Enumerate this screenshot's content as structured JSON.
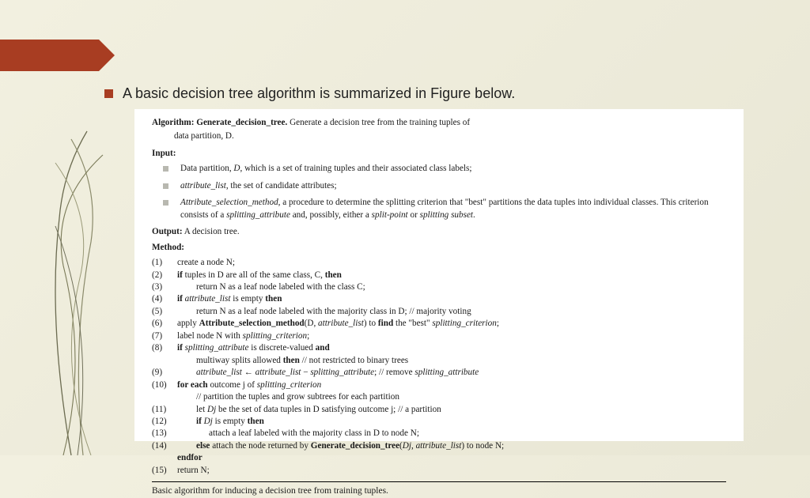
{
  "intro": "A basic decision tree algorithm is summarized in Figure below.",
  "alg": {
    "head_bold": "Algorithm: Generate_decision_tree.",
    "head_rest": " Generate a decision tree from the training tuples of",
    "head_line2": "data partition, D.",
    "input_label": "Input:",
    "inputs": {
      "i1_a": "Data partition, ",
      "i1_b": "D",
      "i1_c": ", which is a set of training tuples and their associated class labels;",
      "i2_a": "attribute_list",
      "i2_b": ", the set of candidate attributes;",
      "i3_a": "Attribute_selection_method",
      "i3_b": ", a procedure to determine the splitting criterion that \"best\" partitions the data tuples into individual classes. This criterion consists of a ",
      "i3_c": "splitting_attribute",
      "i3_d": " and, possibly, either a ",
      "i3_e": "split-point",
      "i3_f": " or ",
      "i3_g": "splitting subset",
      "i3_h": "."
    },
    "output_b": "Output:",
    "output_t": " A decision tree.",
    "method_label": "Method:",
    "s1": "create a node N;",
    "s2_a": "if ",
    "s2_b": "tuples in D are all of the same class, C, ",
    "s2_c": "then",
    "s3": "return N as a leaf node labeled with the class C;",
    "s4_a": "if ",
    "s4_b": "attribute_list",
    "s4_c": " is empty ",
    "s4_d": "then",
    "s5_a": "return N as a leaf node labeled with the majority class in D; ",
    "s5_b": "// majority voting",
    "s6_a": "apply ",
    "s6_b": "Attribute_selection_method",
    "s6_c": "(D, ",
    "s6_d": "attribute_list",
    "s6_e": ") to ",
    "s6_f": "find",
    "s6_g": " the \"best\" ",
    "s6_h": "splitting_criterion",
    "s6_i": ";",
    "s7_a": "label node N with ",
    "s7_b": "splitting_criterion",
    "s7_c": ";",
    "s8_a": "if ",
    "s8_b": "splitting_attribute",
    "s8_c": " is discrete-valued ",
    "s8_d": "and",
    "s8l2_a": "multiway splits allowed ",
    "s8l2_b": "then ",
    "s8l2_c": "// not restricted to binary trees",
    "s9_a": "attribute_list",
    "s9_b": " ← ",
    "s9_c": "attribute_list",
    "s9_d": " − ",
    "s9_e": "splitting_attribute",
    "s9_f": "; // remove ",
    "s9_g": "splitting_attribute",
    "s10_a": "for each ",
    "s10_b": "outcome j of ",
    "s10_c": "splitting_criterion",
    "s10l2": "// partition the tuples and grow subtrees for each partition",
    "s11_a": "let ",
    "s11_b": "Dj",
    "s11_c": " be the set of data tuples in D satisfying outcome j; // a partition",
    "s12_a": "if ",
    "s12_b": "Dj",
    "s12_c": " is empty ",
    "s12_d": "then",
    "s13": "attach a leaf labeled with the majority class in D to node N;",
    "s14_a": "else ",
    "s14_b": "attach the node returned by ",
    "s14_c": "Generate_decision_tree",
    "s14_d": "(",
    "s14_e": "Dj",
    "s14_f": ", ",
    "s14_g": "attribute_list",
    "s14_h": ") to node N;",
    "endfor": "endfor",
    "s15": "return N;",
    "caption": "Basic algorithm for inducing a decision tree from training tuples."
  },
  "nums": {
    "n1": "(1)",
    "n2": "(2)",
    "n3": "(3)",
    "n4": "(4)",
    "n5": "(5)",
    "n6": "(6)",
    "n7": "(7)",
    "n8": "(8)",
    "n9": "(9)",
    "n10": "(10)",
    "n11": "(11)",
    "n12": "(12)",
    "n13": "(13)",
    "n14": "(14)",
    "n15": "(15)"
  }
}
